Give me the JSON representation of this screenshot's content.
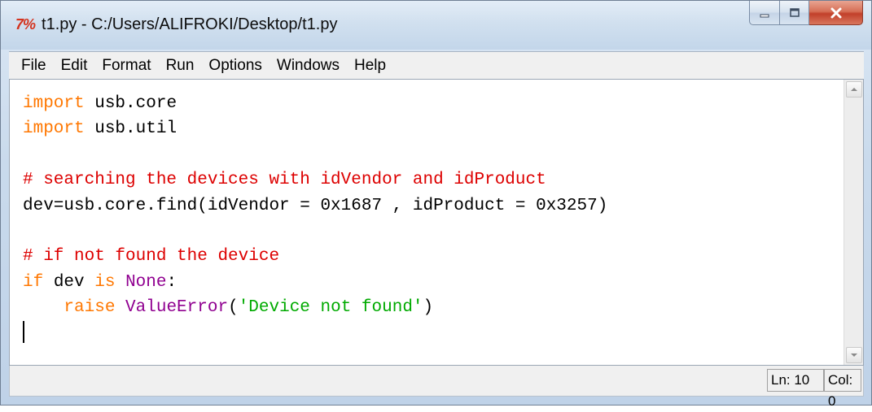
{
  "window": {
    "app_icon": "7%",
    "title": "t1.py - C:/Users/ALIFROKI/Desktop/t1.py",
    "controls": {
      "minimize": "minimize-icon",
      "maximize": "maximize-icon",
      "close": "close-icon"
    }
  },
  "menu": {
    "items": [
      "File",
      "Edit",
      "Format",
      "Run",
      "Options",
      "Windows",
      "Help"
    ]
  },
  "editor": {
    "lines": [
      [
        {
          "t": "import",
          "c": "kw"
        },
        {
          "t": " usb.core",
          "c": ""
        }
      ],
      [
        {
          "t": "import",
          "c": "kw"
        },
        {
          "t": " usb.util",
          "c": ""
        }
      ],
      [],
      [
        {
          "t": "# searching the devices with idVendor and idProduct",
          "c": "cm"
        }
      ],
      [
        {
          "t": "dev=usb.core.find(idVendor = 0x1687 , idProduct = 0x3257)",
          "c": ""
        }
      ],
      [],
      [
        {
          "t": "# if not found the device",
          "c": "cm"
        }
      ],
      [
        {
          "t": "if",
          "c": "kw"
        },
        {
          "t": " dev ",
          "c": ""
        },
        {
          "t": "is",
          "c": "kw"
        },
        {
          "t": " ",
          "c": ""
        },
        {
          "t": "None",
          "c": "bi"
        },
        {
          "t": ":",
          "c": ""
        }
      ],
      [
        {
          "t": "    ",
          "c": ""
        },
        {
          "t": "raise",
          "c": "kw"
        },
        {
          "t": " ",
          "c": ""
        },
        {
          "t": "ValueError",
          "c": "bi"
        },
        {
          "t": "(",
          "c": ""
        },
        {
          "t": "'Device not found'",
          "c": "st"
        },
        {
          "t": ")",
          "c": ""
        }
      ],
      []
    ],
    "cursor_line": 10
  },
  "status": {
    "ln": "Ln: 10",
    "col": "Col: 0"
  },
  "colors": {
    "keyword": "#ff7700",
    "comment": "#dd0000",
    "builtin": "#900090",
    "string": "#00aa00",
    "close_button": "#c2402a"
  }
}
